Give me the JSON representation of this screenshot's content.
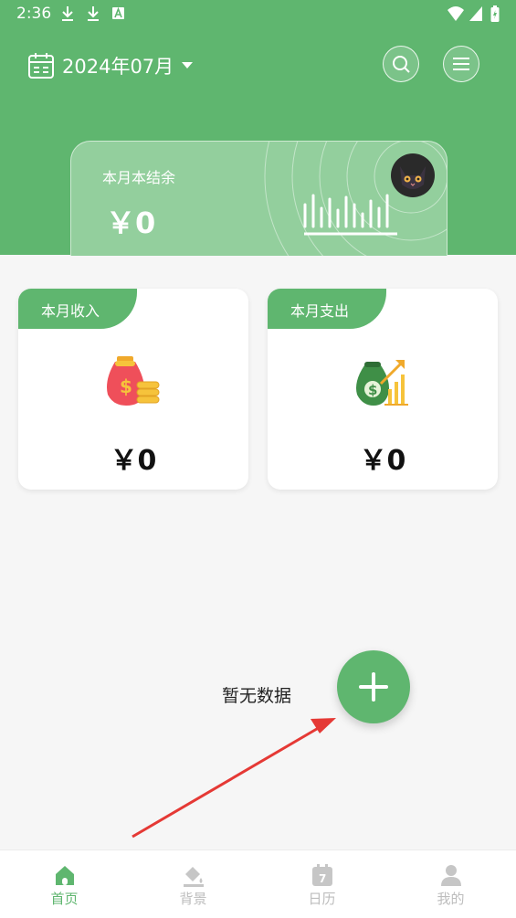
{
  "status_bar": {
    "time": "2:36"
  },
  "header": {
    "month": "2024年07月"
  },
  "balance_card": {
    "label": "本月本结余",
    "value": "￥0"
  },
  "income_card": {
    "tag": "本月收入",
    "value": "￥0",
    "icon": "money-bag-icon"
  },
  "expense_card": {
    "tag": "本月支出",
    "value": "￥0",
    "icon": "money-growth-icon"
  },
  "empty_state": {
    "text": "暂无数据"
  },
  "bottom_nav": {
    "items": [
      {
        "label": "首页",
        "icon": "home-icon",
        "active": true
      },
      {
        "label": "背景",
        "icon": "paint-bucket-icon",
        "active": false
      },
      {
        "label": "日历",
        "icon": "calendar-icon",
        "active": false
      },
      {
        "label": "我的",
        "icon": "user-icon",
        "active": false
      }
    ]
  },
  "colors": {
    "primary": "#5fb66f",
    "card_light": "#93cf9d",
    "annotation_arrow": "#e53935"
  }
}
